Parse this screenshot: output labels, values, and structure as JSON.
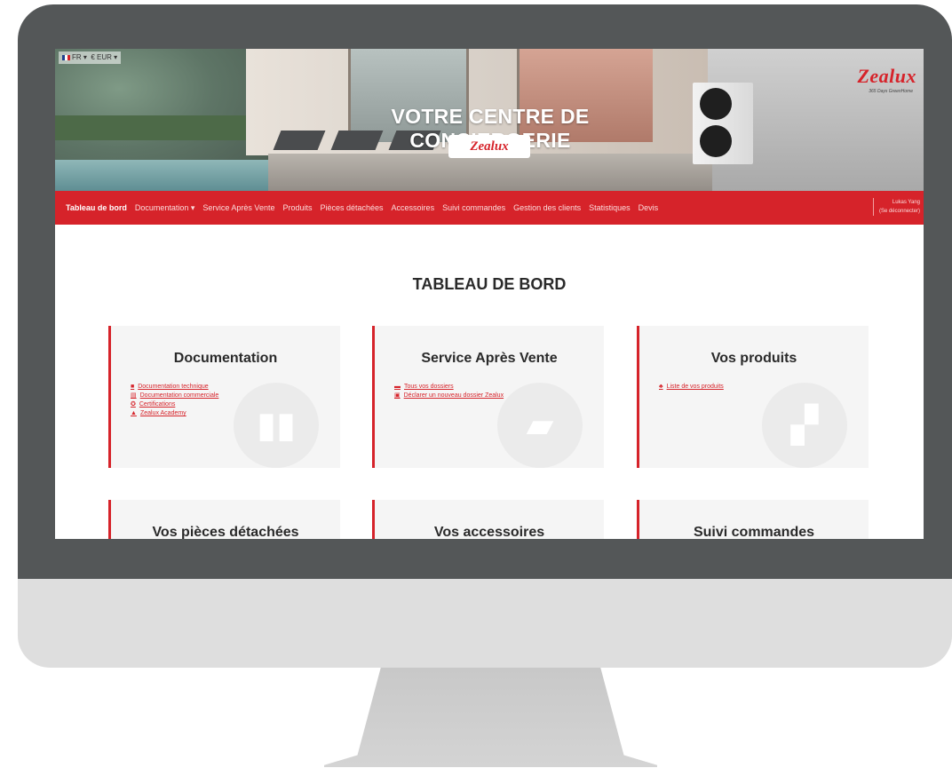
{
  "locale": {
    "language": "FR",
    "currency": "€ EUR"
  },
  "banner": {
    "title": "VOTRE CENTRE DE CONCIERGERIE",
    "center_logo": "Zealux",
    "brand_logo": "Zealux",
    "brand_tagline": "365 Days GreenHome"
  },
  "nav": {
    "items": [
      {
        "label": "Tableau de bord",
        "active": true
      },
      {
        "label": "Documentation ▾",
        "active": false
      },
      {
        "label": "Service Après Vente",
        "active": false
      },
      {
        "label": "Produits",
        "active": false
      },
      {
        "label": "Pièces détachées",
        "active": false
      },
      {
        "label": "Accessoires",
        "active": false
      },
      {
        "label": "Suivi commandes",
        "active": false
      },
      {
        "label": "Gestion des clients",
        "active": false
      },
      {
        "label": "Statistiques",
        "active": false
      },
      {
        "label": "Devis",
        "active": false
      }
    ],
    "user_name": "Lukas Yang",
    "logout_label": "(Se déconnecter)"
  },
  "page_title": "TABLEAU DE BORD",
  "cards": [
    {
      "title": "Documentation",
      "links": [
        {
          "icon": "book-icon",
          "label": "Documentation technique"
        },
        {
          "icon": "file-icon",
          "label": "Documentation commerciale"
        },
        {
          "icon": "certificate-icon",
          "label": "Certifications"
        },
        {
          "icon": "graduation-cap-icon",
          "label": "Zealux Academy"
        }
      ],
      "bg_icon": "book-icon"
    },
    {
      "title": "Service Après Vente",
      "links": [
        {
          "icon": "folder-icon",
          "label": "Tous vos dossiers"
        },
        {
          "icon": "folder-plus-icon",
          "label": "Déclarer un nouveau dossier Zealux"
        }
      ],
      "bg_icon": "folder-open-icon"
    },
    {
      "title": "Vos produits",
      "links": [
        {
          "icon": "boxes-icon",
          "label": "Liste de vos produits"
        }
      ],
      "bg_icon": "boxes-icon"
    },
    {
      "title": "Vos pièces détachées",
      "links": []
    },
    {
      "title": "Vos accessoires",
      "links": []
    },
    {
      "title": "Suivi commandes",
      "links": []
    }
  ],
  "colors": {
    "accent": "#d6232a",
    "monitor_bezel": "#545758",
    "card_bg": "#f5f5f5"
  }
}
